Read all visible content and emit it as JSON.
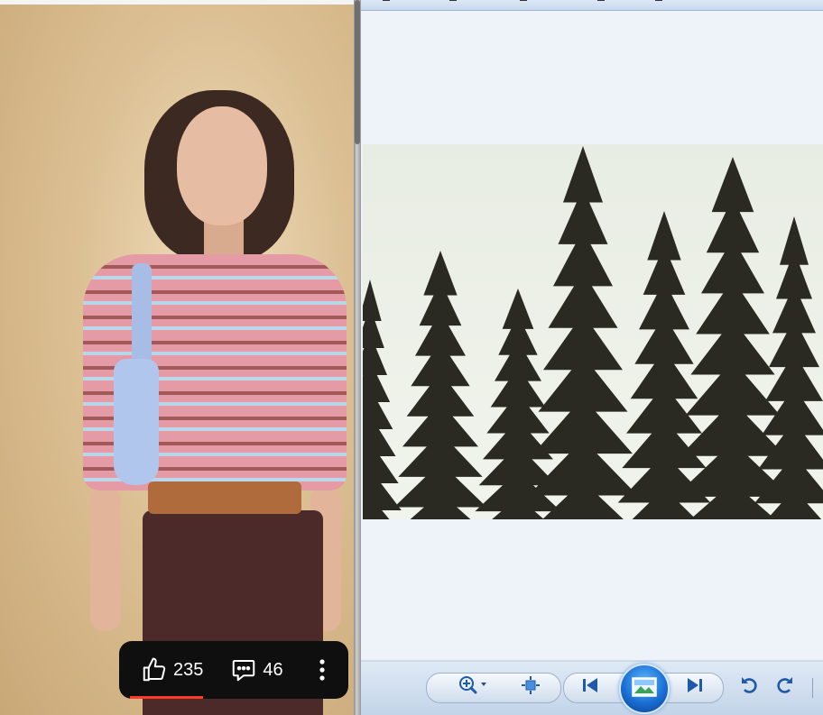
{
  "video_short": {
    "likes": "235",
    "comments": "46",
    "icons": {
      "like": "thumbs-up-icon",
      "comment": "comment-bubble-icon",
      "more": "more-vertical-icon"
    },
    "colors": {
      "action_bar": "#0f0f0f",
      "progress": "#ff3a2a"
    },
    "progress_fraction": 0.33
  },
  "photo_viewer": {
    "toolbar": {
      "zoom": "zoom-icon",
      "fit": "actual-size-icon",
      "previous": "previous-icon",
      "slideshow": "slideshow-icon",
      "next": "next-icon",
      "rotate_left": "rotate-counterclockwise-icon",
      "rotate_right": "rotate-clockwise-icon"
    },
    "colors": {
      "background": "#eef3fa",
      "toolbar": "#c3d4e9",
      "trees": "#2a2a22"
    }
  }
}
